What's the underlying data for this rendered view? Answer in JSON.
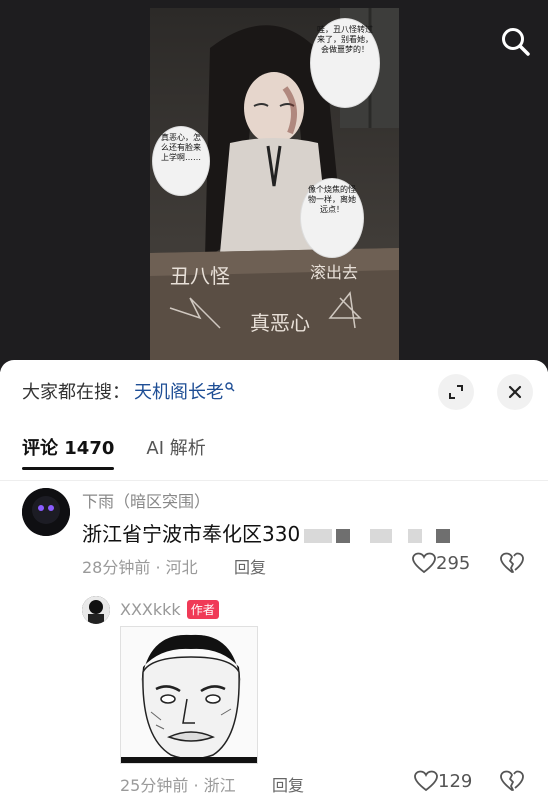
{
  "video": {
    "bubbles": [
      "哇，丑八怪转过来了，别看她，会做噩梦的！",
      "真恶心，怎么还有脸来上学啊……",
      "像个烧焦的怪物一样，离她远点！"
    ],
    "desk_texts": [
      "丑八怪",
      "滚出去",
      "真恶心"
    ]
  },
  "search_icon": "search-icon",
  "hot_search": {
    "prefix": "大家都在搜：",
    "term": "天机阁长老"
  },
  "tabs": [
    {
      "label": "评论 1470"
    },
    {
      "label": "AI 解析"
    }
  ],
  "comments": [
    {
      "username": "下雨（暗区突围）",
      "text": "浙江省宁波市奉化区330",
      "time": "28分钟前 · 河北",
      "reply_label": "回复",
      "likes": "295"
    },
    {
      "username": "XXXkkk",
      "badge": "作者",
      "time": "25分钟前 · 浙江",
      "reply_label": "回复",
      "likes": "129"
    }
  ]
}
